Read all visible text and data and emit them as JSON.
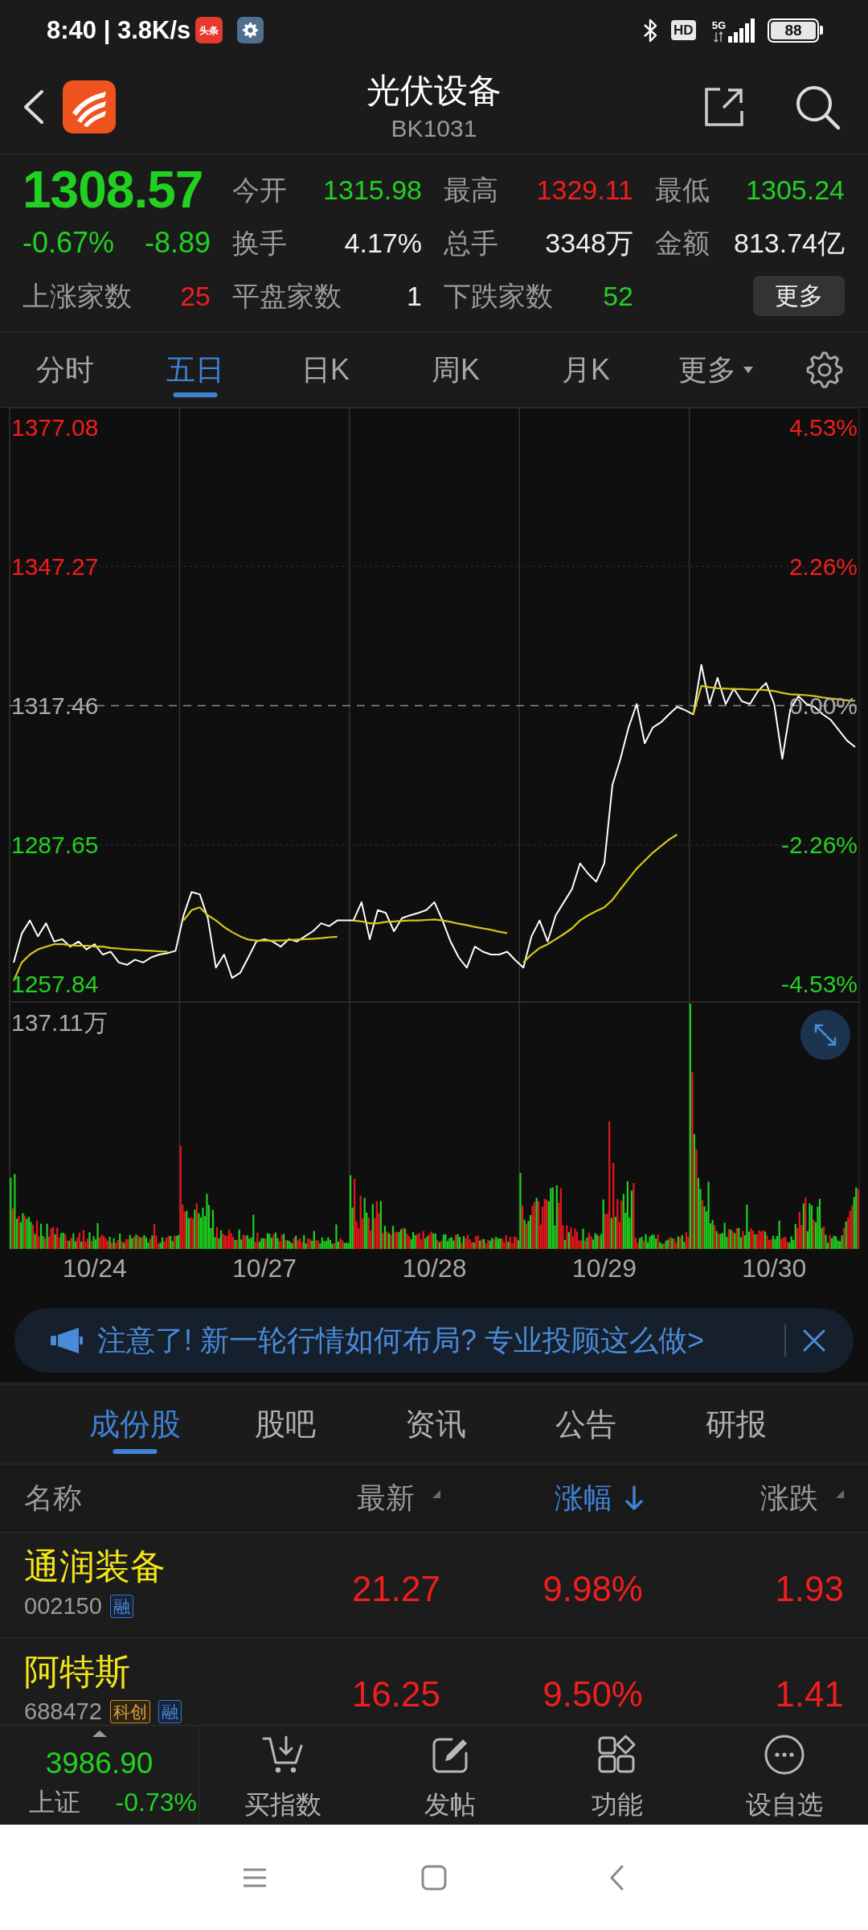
{
  "status_bar": {
    "time_and_speed": "8:40 | 3.8K/s",
    "app_icon_label": "头条",
    "hd_badge": "HD",
    "network": "5G",
    "battery": "88"
  },
  "header": {
    "title": "光伏设备",
    "code": "BK1031"
  },
  "quote": {
    "price": "1308.57",
    "change_percent": "-0.67%",
    "change": "-8.89",
    "color": "#22d022",
    "stats": [
      {
        "label": "今开",
        "value": "1315.98",
        "color": "#22d022"
      },
      {
        "label": "最高",
        "value": "1329.11",
        "color": "#f01e1e"
      },
      {
        "label": "最低",
        "value": "1305.24",
        "color": "#22d022"
      },
      {
        "label": "换手",
        "value": "4.17%",
        "color": "#f0f0f0"
      },
      {
        "label": "总手",
        "value": "3348万",
        "color": "#f0f0f0"
      },
      {
        "label": "金额",
        "value": "813.74亿",
        "color": "#f0f0f0"
      },
      {
        "label": "上涨家数",
        "value": "25",
        "color": "#f01e1e"
      },
      {
        "label": "平盘家数",
        "value": "1",
        "color": "#f0f0f0"
      },
      {
        "label": "下跌家数",
        "value": "52",
        "color": "#22d022"
      }
    ],
    "more_button": "更多"
  },
  "chart_tabs": [
    {
      "label": "分时",
      "kind": "tab",
      "selected": false
    },
    {
      "label": "五日",
      "kind": "tab",
      "selected": true
    },
    {
      "label": "日K",
      "kind": "tab",
      "selected": false
    },
    {
      "label": "周K",
      "kind": "tab",
      "selected": false
    },
    {
      "label": "月K",
      "kind": "tab",
      "selected": false
    },
    {
      "label": "更多",
      "kind": "dropdown",
      "selected": false
    }
  ],
  "price_chart": {
    "chart_data": {
      "type": "line",
      "categories": [
        null,
        null,
        null,
        null,
        null,
        null,
        null,
        null,
        null,
        null,
        "10/24",
        null,
        null,
        null,
        null,
        null,
        null,
        null,
        null,
        null,
        null,
        null,
        null,
        null,
        null,
        null,
        null,
        null,
        null,
        null,
        null,
        "10/27",
        null,
        null,
        null,
        null,
        null,
        null,
        null,
        null,
        null,
        null,
        null,
        null,
        null,
        null,
        null,
        null,
        null,
        null,
        null,
        null,
        "10/28",
        null,
        null,
        null,
        null,
        null,
        null,
        null,
        null,
        null,
        null,
        null,
        null,
        null,
        null,
        null,
        null,
        null,
        null,
        null,
        null,
        "10/29",
        null,
        null,
        null,
        null,
        null,
        null,
        null,
        null,
        null,
        null,
        null,
        null,
        null,
        null,
        null,
        null,
        null,
        null,
        null,
        null,
        "10/30",
        null,
        null,
        null,
        null,
        null,
        null,
        null,
        null,
        null,
        null
      ],
      "ylim": [
        1201.23,
        1381.21
      ],
      "yticks": [
        1377.08,
        1347.27,
        1317.46,
        1287.65,
        1257.84
      ],
      "series": [
        {
          "color": "#ffffff",
          "values": [
            1262.5,
            1268.7,
            1271.5,
            1268.1,
            1270.9,
            1267.0,
            1267.5,
            1265.9,
            1267.0,
            1265.3,
            1266.4,
            1264.2,
            1264.8,
            1262.5,
            1262.0,
            1263.1,
            1262.5,
            1263.6,
            1264.2,
            1264.5,
            1265.0,
            1272.6,
            1277.6,
            1277.1,
            1272.0,
            1261.4,
            1264.2,
            1259.2,
            1260.3,
            1263.6,
            1267.0,
            1267.5,
            1267.0,
            1265.9,
            1267.5,
            1267.0,
            1268.1,
            1269.2,
            1270.9,
            1270.3,
            1271.5,
            1271.5,
            1271.5,
            1275.4,
            1267.5,
            1273.7,
            1273.1,
            1269.2,
            1272.0,
            1272.6,
            1273.1,
            1273.7,
            1275.4,
            1271.5,
            1267.0,
            1263.6,
            1261.4,
            1265.9,
            1264.8,
            1264.2,
            1264.2,
            1264.8,
            1263.0,
            1261.4,
            1268.1,
            1271.5,
            1267.0,
            1272.6,
            1275.4,
            1278.2,
            1283.7,
            1281.5,
            1279.8,
            1283.7,
            1300.5,
            1306.1,
            1312.8,
            1317.8,
            1309.4,
            1312.8,
            1313.9,
            1315.6,
            1317.2,
            1316.5,
            1315.6,
            1326.2,
            1317.8,
            1323.4,
            1317.8,
            1321.1,
            1318.4,
            1317.8,
            1320.6,
            1322.3,
            1317.8,
            1306.1,
            1316.7,
            1319.5,
            1317.8,
            1317.2,
            1315.6,
            1314.4,
            1312.2,
            1310.0,
            1308.6
          ]
        },
        {
          "color": "#d8c61a",
          "values": [
            1258.6,
            1262.5,
            1264.2,
            1265.3,
            1265.9,
            1266.4,
            1266.4,
            1266.2,
            1266.1,
            1266.1,
            1265.9,
            1265.9,
            1265.6,
            1265.5,
            1265.3,
            1265.2,
            1265.1,
            1265.0,
            1264.9,
            1264.8,
            null,
            1271.5,
            1273.7,
            1274.3,
            1272.6,
            1271.5,
            1270.1,
            1269.0,
            1268.1,
            1267.4,
            1267.2,
            1267.2,
            1267.2,
            1267.2,
            1267.3,
            1267.4,
            1267.5,
            1267.6,
            1267.7,
            1267.9,
            1268.0,
            null,
            1271.5,
            1271.3,
            1270.9,
            1270.9,
            1271.2,
            1271.3,
            1271.4,
            1271.5,
            1271.5,
            1271.6,
            1271.7,
            1271.5,
            1271.2,
            1270.8,
            1270.5,
            1270.1,
            1269.8,
            1269.5,
            1269.1,
            1268.8,
            null,
            1262.5,
            1264.2,
            1265.6,
            1266.4,
            1267.5,
            1268.6,
            1269.8,
            1271.5,
            1272.6,
            1273.5,
            1274.3,
            1275.9,
            1278.2,
            1280.4,
            1282.6,
            1284.3,
            1286.0,
            1287.4,
            1288.8,
            1289.9,
            null,
            1315.6,
            1321.7,
            1321.4,
            1321.2,
            1321.1,
            1321.0,
            1321.0,
            1320.9,
            1320.9,
            1320.8,
            1320.6,
            1320.2,
            1319.9,
            1319.8,
            1319.7,
            1319.5,
            1319.2,
            1319.0,
            1318.8,
            1318.6,
            1318.5
          ]
        }
      ],
      "ref_lines": [
        {
          "axis": "y",
          "value": 1317.46
        }
      ]
    },
    "right_labels": [
      "4.53%",
      "2.26%",
      "0.00%",
      "-2.26%",
      "-4.53%"
    ],
    "volume_label": "137.11万"
  },
  "banner": {
    "text": "注意了! 新一轮行情如何布局? 专业投顾这么做>"
  },
  "content_tabs": [
    {
      "label": "成份股",
      "selected": true
    },
    {
      "label": "股吧",
      "selected": false
    },
    {
      "label": "资讯",
      "selected": false
    },
    {
      "label": "公告",
      "selected": false
    },
    {
      "label": "研报",
      "selected": false
    }
  ],
  "table": {
    "columns": [
      {
        "label": "名称",
        "sortable": false
      },
      {
        "label": "最新",
        "sortable": true,
        "selected": false
      },
      {
        "label": "涨幅",
        "sortable": true,
        "selected": true
      },
      {
        "label": "涨跌",
        "sortable": true,
        "selected": false
      }
    ],
    "rows": [
      {
        "name": "通润装备",
        "code": "002150",
        "badges": [
          {
            "text": "融",
            "kind": "margin"
          }
        ],
        "latest": "21.27",
        "change_percent": "9.98%",
        "change": "1.93",
        "color": "#f01e1e"
      },
      {
        "name": "阿特斯",
        "code": "688472",
        "badges": [
          {
            "text": "科创",
            "kind": "star_market"
          },
          {
            "text": "融",
            "kind": "margin"
          }
        ],
        "latest": "16.25",
        "change_percent": "9.50%",
        "change": "1.41",
        "color": "#f01e1e"
      }
    ]
  },
  "bottom_bar": {
    "index": {
      "value": "3986.90",
      "name": "上证",
      "change": "-0.73%",
      "color": "#22d022"
    },
    "items": [
      {
        "label": "买指数"
      },
      {
        "label": "发帖"
      },
      {
        "label": "功能"
      },
      {
        "label": "设自选"
      }
    ]
  }
}
